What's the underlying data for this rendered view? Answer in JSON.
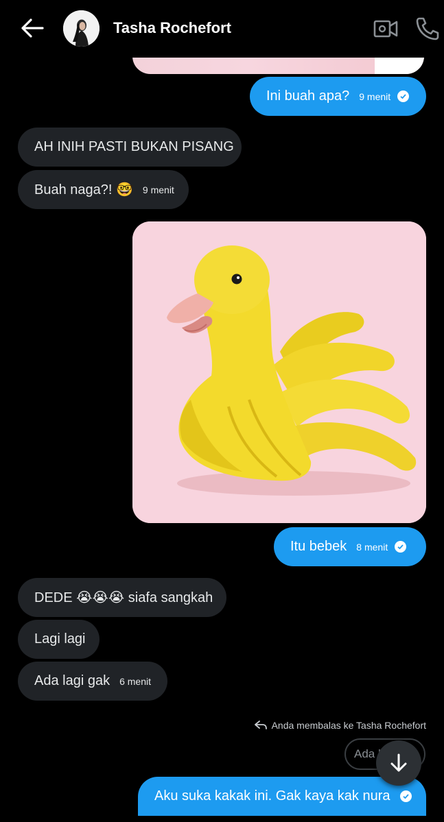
{
  "header": {
    "contact_name": "Tasha Rochefort",
    "icons": {
      "back": "arrow-left-icon",
      "video": "video-call-icon",
      "phone": "phone-icon"
    }
  },
  "messages": [
    {
      "type": "image",
      "side": "out",
      "content": "cropped-image"
    },
    {
      "type": "text",
      "side": "out",
      "text": "Ini buah apa?",
      "time": "9 menit",
      "status": "read"
    },
    {
      "type": "text",
      "side": "in",
      "text": "AH INIH PASTI BUKAN PISANG"
    },
    {
      "type": "text",
      "side": "in",
      "text": "Buah naga?! 🤓",
      "time": "9 menit"
    },
    {
      "type": "image",
      "side": "out",
      "content": "duck-made-of-bananas"
    },
    {
      "type": "text",
      "side": "out",
      "text": "Itu bebek",
      "time": "8 menit",
      "status": "read"
    },
    {
      "type": "text",
      "side": "in",
      "text": "DEDE 😭😭😭 siafa sangkah"
    },
    {
      "type": "text",
      "side": "in",
      "text": "Lagi lagi"
    },
    {
      "type": "text",
      "side": "in",
      "text": "Ada lagi gak",
      "time": "6 menit"
    },
    {
      "type": "reply",
      "side": "out",
      "reply_label": "Anda membalas ke Tasha Rochefort",
      "quoted_preview": "Ada l",
      "text": "Aku suka kakak ini. Gak kaya kak nura",
      "status": "read"
    }
  ],
  "colors": {
    "background": "#000000",
    "outgoing_bubble": "#1d9bf0",
    "incoming_bubble": "#202327"
  },
  "scroll_button": {
    "icon": "arrow-down-icon"
  }
}
